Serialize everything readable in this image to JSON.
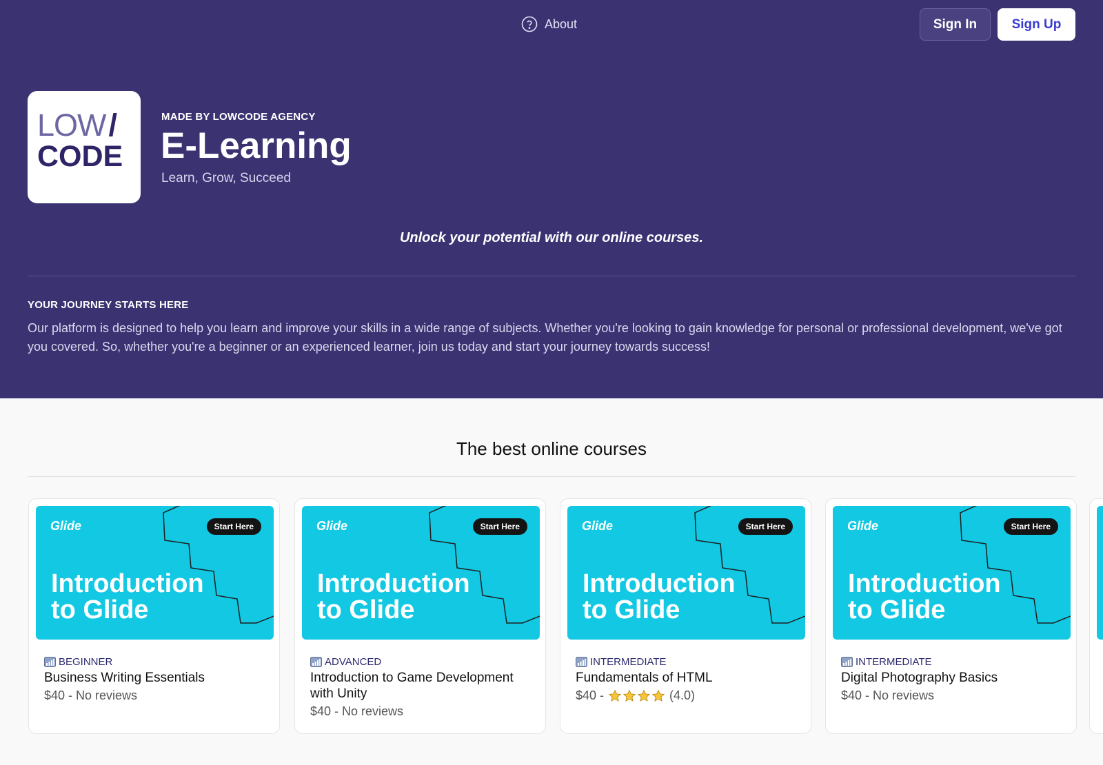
{
  "nav": {
    "about_label": "About",
    "about_icon": "question-circle-icon",
    "sign_in_label": "Sign In",
    "sign_up_label": "Sign Up"
  },
  "brand": {
    "logo_line1": "LOW",
    "logo_slash": "/",
    "logo_line2": "CODE",
    "made_by": "MADE BY LOWCODE AGENCY",
    "title": "E-Learning",
    "tagline": "Learn, Grow, Succeed"
  },
  "hero": {
    "headline": "Unlock your potential with our online courses.",
    "journey_heading": "YOUR JOURNEY STARTS HERE",
    "journey_text": "Our platform is designed to help you learn and improve your skills in a wide range of subjects. Whether you're looking to gain knowledge for personal or professional development, we've got you covered. So, whether you're a beginner or an experienced learner, join us today and start your journey towards success!"
  },
  "courses_section": {
    "title": "The best online courses",
    "thumbnail": {
      "brand": "Glide",
      "badge": "Start Here",
      "title_line1": "Introduction",
      "title_line2": "to Glide"
    },
    "courses": [
      {
        "level": "BEGINNER",
        "name": "Business Writing Essentials",
        "price_text": "$40 - No reviews"
      },
      {
        "level": "ADVANCED",
        "name": "Introduction to Game Development with Unity",
        "price_text": "$40 - No reviews"
      },
      {
        "level": "INTERMEDIATE",
        "name": "Fundamentals of HTML",
        "price_prefix": "$40 -",
        "rating": 4,
        "rating_text": "(4.0)"
      },
      {
        "level": "INTERMEDIATE",
        "name": "Digital Photography Basics",
        "price_text": "$40 - No reviews"
      }
    ]
  },
  "colors": {
    "hero_bg": "#3b3272",
    "thumb_bg": "#12c8e3",
    "accent": "#3b3ad0"
  }
}
